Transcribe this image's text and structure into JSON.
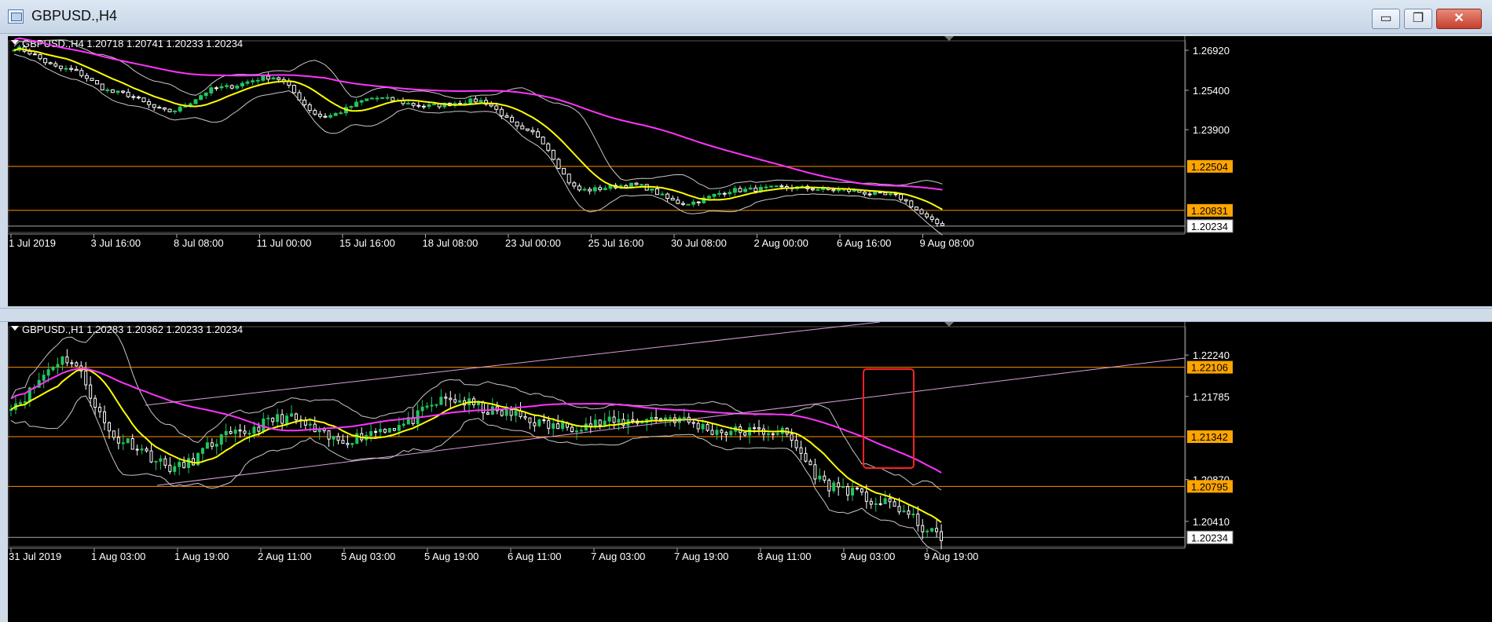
{
  "window": {
    "title": "GBPUSD.,H4",
    "buttons": {
      "minimize": "▭",
      "maximize": "❐",
      "close": "✕"
    }
  },
  "colors": {
    "background": "#000000",
    "bull": "#22c55e",
    "bear": "#ffffff",
    "ma_fast": "#ffff00",
    "ma_slow": "#ff33ff",
    "bands": "#c8c8c8",
    "level_line": "#ff8c00",
    "tag_bg": "#ffa500",
    "highlight_box": "#ff2222"
  },
  "charts": [
    {
      "id": "h4",
      "header": "GBPUSD.,H4  1.20718 1.20741 1.20233 1.20234",
      "price_labels": [
        {
          "label": "1.26920",
          "value": 1.2692
        },
        {
          "label": "1.25400",
          "value": 1.254
        },
        {
          "label": "1.23900",
          "value": 1.239
        }
      ],
      "tags": [
        {
          "label": "1.22504",
          "value": 1.22504,
          "style": "orange"
        },
        {
          "label": "1.20831",
          "value": 1.20831,
          "style": "orange"
        },
        {
          "label": "1.20234",
          "value": 1.20234,
          "style": "white"
        }
      ],
      "time_labels": [
        "1 Jul 2019",
        "3 Jul 16:00",
        "8 Jul 08:00",
        "11 Jul 00:00",
        "15 Jul 16:00",
        "18 Jul 08:00",
        "23 Jul 00:00",
        "25 Jul 16:00",
        "30 Jul 08:00",
        "2 Aug 00:00",
        "6 Aug 16:00",
        "9 Aug 08:00"
      ]
    },
    {
      "id": "h1",
      "header": "GBPUSD.,H1  1.20283 1.20362 1.20233 1.20234",
      "price_labels": [
        {
          "label": "1.22240",
          "value": 1.2224
        },
        {
          "label": "1.21785",
          "value": 1.21785
        },
        {
          "label": "1.20870",
          "value": 1.2087
        },
        {
          "label": "1.20410",
          "value": 1.2041
        }
      ],
      "tags": [
        {
          "label": "1.22106",
          "value": 1.22106,
          "style": "orange"
        },
        {
          "label": "1.21342",
          "value": 1.21342,
          "style": "orange"
        },
        {
          "label": "1.20795",
          "value": 1.20795,
          "style": "orange"
        },
        {
          "label": "1.20234",
          "value": 1.20234,
          "style": "white"
        }
      ],
      "time_labels": [
        "31 Jul 2019",
        "1 Aug 03:00",
        "1 Aug 19:00",
        "2 Aug 11:00",
        "5 Aug 03:00",
        "5 Aug 19:00",
        "6 Aug 11:00",
        "7 Aug 03:00",
        "7 Aug 19:00",
        "8 Aug 11:00",
        "9 Aug 03:00",
        "9 Aug 19:00"
      ]
    }
  ]
}
